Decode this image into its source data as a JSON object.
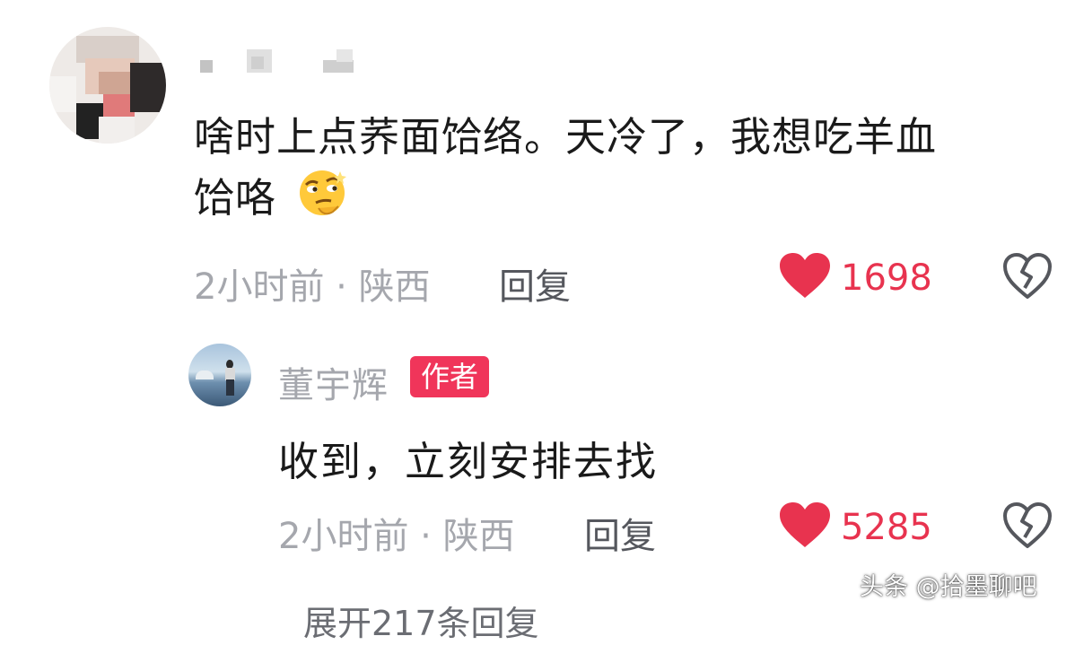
{
  "comment": {
    "text_line1": "啥时上点荞面饸络。天冷了，我想吃羊血",
    "text_line2": "饸咯",
    "emoji": "thinking-smirk-emoji",
    "time": "2小时前",
    "location": "陕西",
    "separator": "·",
    "reply_label": "回复",
    "likes": "1698"
  },
  "reply": {
    "author": "董宇辉",
    "badge": "作者",
    "text": "收到，立刻安排去找",
    "time": "2小时前",
    "location": "陕西",
    "separator": "·",
    "reply_label": "回复",
    "likes": "5285"
  },
  "expand_label": "展开217条回复",
  "watermark": "头条 @拾墨聊吧",
  "colors": {
    "like_red": "#e8334f",
    "badge_red": "#f0355a",
    "meta_gray": "#a5a7ad",
    "text_dark": "#1a1a1a"
  }
}
